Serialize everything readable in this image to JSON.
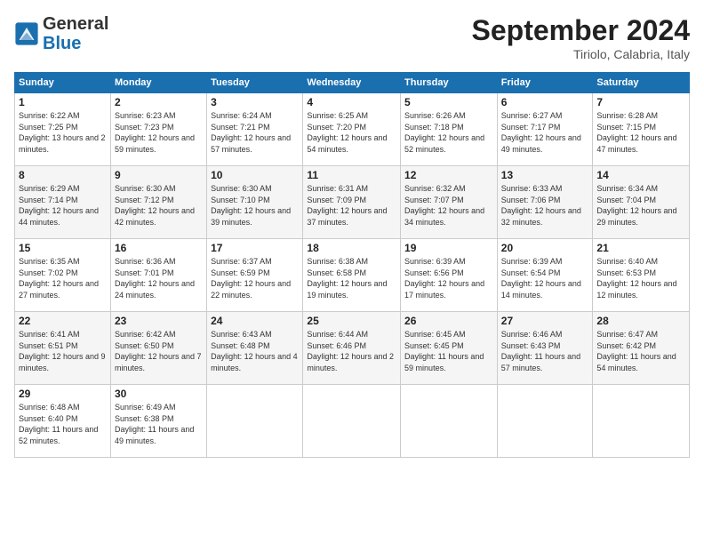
{
  "header": {
    "logo_general": "General",
    "logo_blue": "Blue",
    "month_title": "September 2024",
    "location": "Tiriolo, Calabria, Italy"
  },
  "weekdays": [
    "Sunday",
    "Monday",
    "Tuesday",
    "Wednesday",
    "Thursday",
    "Friday",
    "Saturday"
  ],
  "weeks": [
    [
      {
        "day": "1",
        "sunrise": "Sunrise: 6:22 AM",
        "sunset": "Sunset: 7:25 PM",
        "daylight": "Daylight: 13 hours and 2 minutes."
      },
      {
        "day": "2",
        "sunrise": "Sunrise: 6:23 AM",
        "sunset": "Sunset: 7:23 PM",
        "daylight": "Daylight: 12 hours and 59 minutes."
      },
      {
        "day": "3",
        "sunrise": "Sunrise: 6:24 AM",
        "sunset": "Sunset: 7:21 PM",
        "daylight": "Daylight: 12 hours and 57 minutes."
      },
      {
        "day": "4",
        "sunrise": "Sunrise: 6:25 AM",
        "sunset": "Sunset: 7:20 PM",
        "daylight": "Daylight: 12 hours and 54 minutes."
      },
      {
        "day": "5",
        "sunrise": "Sunrise: 6:26 AM",
        "sunset": "Sunset: 7:18 PM",
        "daylight": "Daylight: 12 hours and 52 minutes."
      },
      {
        "day": "6",
        "sunrise": "Sunrise: 6:27 AM",
        "sunset": "Sunset: 7:17 PM",
        "daylight": "Daylight: 12 hours and 49 minutes."
      },
      {
        "day": "7",
        "sunrise": "Sunrise: 6:28 AM",
        "sunset": "Sunset: 7:15 PM",
        "daylight": "Daylight: 12 hours and 47 minutes."
      }
    ],
    [
      {
        "day": "8",
        "sunrise": "Sunrise: 6:29 AM",
        "sunset": "Sunset: 7:14 PM",
        "daylight": "Daylight: 12 hours and 44 minutes."
      },
      {
        "day": "9",
        "sunrise": "Sunrise: 6:30 AM",
        "sunset": "Sunset: 7:12 PM",
        "daylight": "Daylight: 12 hours and 42 minutes."
      },
      {
        "day": "10",
        "sunrise": "Sunrise: 6:30 AM",
        "sunset": "Sunset: 7:10 PM",
        "daylight": "Daylight: 12 hours and 39 minutes."
      },
      {
        "day": "11",
        "sunrise": "Sunrise: 6:31 AM",
        "sunset": "Sunset: 7:09 PM",
        "daylight": "Daylight: 12 hours and 37 minutes."
      },
      {
        "day": "12",
        "sunrise": "Sunrise: 6:32 AM",
        "sunset": "Sunset: 7:07 PM",
        "daylight": "Daylight: 12 hours and 34 minutes."
      },
      {
        "day": "13",
        "sunrise": "Sunrise: 6:33 AM",
        "sunset": "Sunset: 7:06 PM",
        "daylight": "Daylight: 12 hours and 32 minutes."
      },
      {
        "day": "14",
        "sunrise": "Sunrise: 6:34 AM",
        "sunset": "Sunset: 7:04 PM",
        "daylight": "Daylight: 12 hours and 29 minutes."
      }
    ],
    [
      {
        "day": "15",
        "sunrise": "Sunrise: 6:35 AM",
        "sunset": "Sunset: 7:02 PM",
        "daylight": "Daylight: 12 hours and 27 minutes."
      },
      {
        "day": "16",
        "sunrise": "Sunrise: 6:36 AM",
        "sunset": "Sunset: 7:01 PM",
        "daylight": "Daylight: 12 hours and 24 minutes."
      },
      {
        "day": "17",
        "sunrise": "Sunrise: 6:37 AM",
        "sunset": "Sunset: 6:59 PM",
        "daylight": "Daylight: 12 hours and 22 minutes."
      },
      {
        "day": "18",
        "sunrise": "Sunrise: 6:38 AM",
        "sunset": "Sunset: 6:58 PM",
        "daylight": "Daylight: 12 hours and 19 minutes."
      },
      {
        "day": "19",
        "sunrise": "Sunrise: 6:39 AM",
        "sunset": "Sunset: 6:56 PM",
        "daylight": "Daylight: 12 hours and 17 minutes."
      },
      {
        "day": "20",
        "sunrise": "Sunrise: 6:39 AM",
        "sunset": "Sunset: 6:54 PM",
        "daylight": "Daylight: 12 hours and 14 minutes."
      },
      {
        "day": "21",
        "sunrise": "Sunrise: 6:40 AM",
        "sunset": "Sunset: 6:53 PM",
        "daylight": "Daylight: 12 hours and 12 minutes."
      }
    ],
    [
      {
        "day": "22",
        "sunrise": "Sunrise: 6:41 AM",
        "sunset": "Sunset: 6:51 PM",
        "daylight": "Daylight: 12 hours and 9 minutes."
      },
      {
        "day": "23",
        "sunrise": "Sunrise: 6:42 AM",
        "sunset": "Sunset: 6:50 PM",
        "daylight": "Daylight: 12 hours and 7 minutes."
      },
      {
        "day": "24",
        "sunrise": "Sunrise: 6:43 AM",
        "sunset": "Sunset: 6:48 PM",
        "daylight": "Daylight: 12 hours and 4 minutes."
      },
      {
        "day": "25",
        "sunrise": "Sunrise: 6:44 AM",
        "sunset": "Sunset: 6:46 PM",
        "daylight": "Daylight: 12 hours and 2 minutes."
      },
      {
        "day": "26",
        "sunrise": "Sunrise: 6:45 AM",
        "sunset": "Sunset: 6:45 PM",
        "daylight": "Daylight: 11 hours and 59 minutes."
      },
      {
        "day": "27",
        "sunrise": "Sunrise: 6:46 AM",
        "sunset": "Sunset: 6:43 PM",
        "daylight": "Daylight: 11 hours and 57 minutes."
      },
      {
        "day": "28",
        "sunrise": "Sunrise: 6:47 AM",
        "sunset": "Sunset: 6:42 PM",
        "daylight": "Daylight: 11 hours and 54 minutes."
      }
    ],
    [
      {
        "day": "29",
        "sunrise": "Sunrise: 6:48 AM",
        "sunset": "Sunset: 6:40 PM",
        "daylight": "Daylight: 11 hours and 52 minutes."
      },
      {
        "day": "30",
        "sunrise": "Sunrise: 6:49 AM",
        "sunset": "Sunset: 6:38 PM",
        "daylight": "Daylight: 11 hours and 49 minutes."
      },
      null,
      null,
      null,
      null,
      null
    ]
  ]
}
